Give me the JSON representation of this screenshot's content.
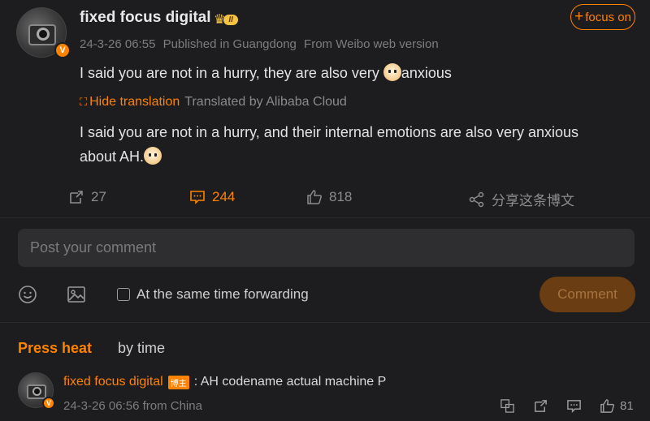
{
  "post": {
    "username": "fixed focus digital",
    "level_badge": "II",
    "follow_label": "focus on",
    "follow_plus": "+",
    "date": "24-3-26 06:55",
    "location": "Published in Guangdong",
    "source": "From Weibo web version",
    "text_before_emoji": "I said you are not in a hurry, they are also very ",
    "text_after_emoji": "anxious",
    "hide_translation": "Hide translation",
    "translated_by": "Translated by Alibaba Cloud",
    "translation_line1": "I said you are not in a hurry, and their internal emotions are also very anxious",
    "translation_line2": "about AH.",
    "v_badge": "V"
  },
  "actions": {
    "repost_count": "27",
    "comment_count": "244",
    "like_count": "818",
    "share_label": "分享这条博文"
  },
  "composer": {
    "placeholder": "Post your comment",
    "forward_label": "At the same time forwarding",
    "submit_label": "Comment"
  },
  "sort": {
    "hot_label": "Press heat",
    "time_label": "by time"
  },
  "comments": [
    {
      "username": "fixed focus digital",
      "tag": "博主",
      "text": ": AH codename actual machine P",
      "meta": "24-3-26 06:56 from China",
      "like_count": "81",
      "v_badge": "V"
    }
  ],
  "colors": {
    "accent": "#ff8200",
    "background": "#1d1d1f",
    "input_bg": "#2e2e30"
  }
}
